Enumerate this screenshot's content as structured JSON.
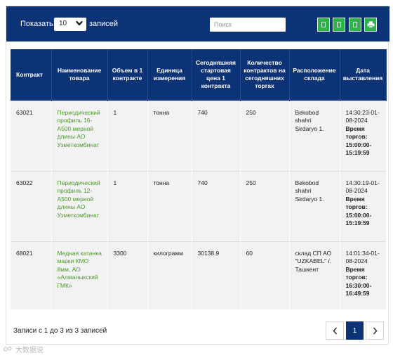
{
  "toolbar": {
    "show_label": "Показать",
    "page_length": "10",
    "records_label": "записей",
    "search_placeholder": "Поиск",
    "buttons": [
      "copy",
      "csv",
      "excel",
      "print"
    ]
  },
  "table": {
    "columns": [
      "Контракт",
      "Наименование товара",
      "Объем в 1 контракте",
      "Единица измерения",
      "Сегодняшняя стартовая цена 1 контракта",
      "Количество контрактов на сегодняшних торгах",
      "Расположение склада",
      "Дата выставления"
    ],
    "rows": [
      {
        "contract": "63021",
        "name": "Периодический профиль 16-A500 мерной длины АО Узметкомбинат",
        "volume": "1",
        "unit": "тонна",
        "price": "740",
        "count": "250",
        "location": "Bekobod shahri Sirdaryo 1.",
        "date": "14:30:23-01-08-2024",
        "trade_label": "Время торгов:",
        "trade_time": "15:00:00-15:19:59"
      },
      {
        "contract": "63022",
        "name": "Периодический профиль 12-A500 мерной длины АО Узметкомбинат",
        "volume": "1",
        "unit": "тонна",
        "price": "740",
        "count": "250",
        "location": "Bekobod shahri Sirdaryo 1.",
        "date": "14:30:19-01-08-2024",
        "trade_label": "Время торгов:",
        "trade_time": "15:00:00-15:19:59"
      },
      {
        "contract": "68021",
        "name": "Медная катанка марки КМО 8мм, АО «Алмалыкский ГМК»",
        "volume": "3300",
        "unit": "килограмм",
        "price": "30138.9",
        "count": "60",
        "location": "склад СП АО \"UZKABEL\" г. Ташкент",
        "date": "14:01:34-01-08-2024",
        "trade_label": "Время торгов:",
        "trade_time": "16:30:00-16:49:59"
      }
    ]
  },
  "footer": {
    "info": "Записи с 1 до 3 из 3 записей",
    "current_page": "1"
  },
  "watermark": {
    "text": "大数据说"
  },
  "colors": {
    "header_bg": "#0d3377",
    "button_green": "#2db34a",
    "link_green": "#4c9a2a",
    "row_bg": "#f2f2f2"
  }
}
